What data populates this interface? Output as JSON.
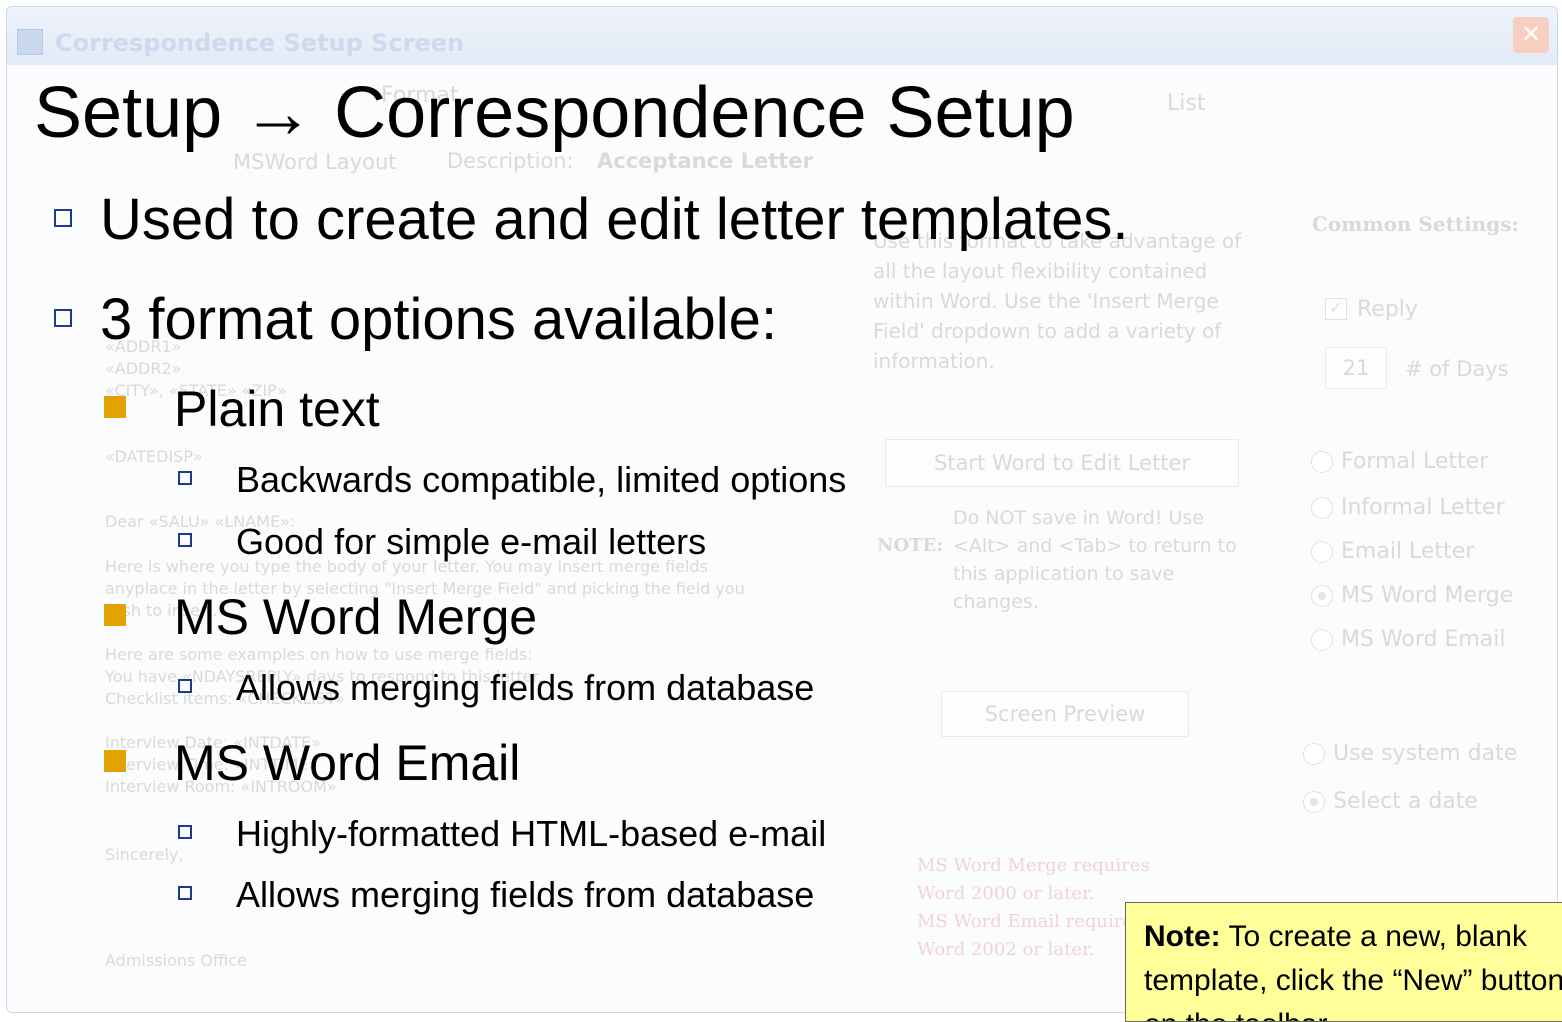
{
  "window": {
    "title": "Correspondence Setup Screen",
    "close_glyph": "✕",
    "labels": {
      "format": "Format",
      "list": "List",
      "msword_layout": "MSWord Layout",
      "description_label": "Description:",
      "description_value": "Acceptance Letter",
      "common_settings": "Common Settings:",
      "reply": "Reply",
      "days_value": "21",
      "days_label": "# of Days",
      "help_line1": "Use this format to take advantage of",
      "help_line2": "all the layout flexibility contained",
      "help_line3": "within Word.  Use the 'Insert Merge",
      "help_line4": "Field' dropdown to add a variety of",
      "help_line5": "information.",
      "start_word_button": "Start Word to Edit Letter",
      "note_label": "NOTE:",
      "note_line1": "Do NOT save in Word!  Use",
      "note_line2": "<Alt> and <Tab> to return to",
      "note_line3": "this application to save",
      "note_line4": "changes.",
      "screen_preview_button": "Screen Preview",
      "use_system_date": "Use system date",
      "select_a_date": "Select a date",
      "req_line1": "MS Word Merge requires",
      "req_line2": "Word 2000 or later.",
      "req_line3": "MS Word Email requires",
      "req_line4": "Word 2002 or later."
    },
    "format_options": [
      "Formal Letter",
      "Informal Letter",
      "Email Letter",
      "MS Word Merge",
      "MS Word Email"
    ],
    "letter_lines": [
      "«ADDR1»",
      "«ADDR2»",
      "«CITY», «STATE» «ZIP»",
      "«DATEDISP»",
      "Dear «SALU» «LNAME»:",
      "Here is where you type the body of your letter.  You may insert merge fields",
      "anyplace in the letter by selecting \"Insert Merge Field\" and picking the field you",
      "wish to insert.",
      "Here are some examples on how to use merge fields:",
      "You have «NDAYSREPLY» days to respond to this letter.",
      "Checklist items: «CHECKLIST»",
      "Interview Date: «INTDATE»",
      "Interview Time: «INTTIME»",
      "Interview Room: «INTROOM»",
      "Sincerely,",
      "Admissions Office"
    ]
  },
  "slide": {
    "title": "Setup → Correspondence Setup",
    "bullets": [
      "Used to create and edit letter templates.",
      "3 format options available:"
    ],
    "options": [
      {
        "label": "Plain text",
        "details": [
          "Backwards compatible, limited options",
          "Good for simple e-mail letters"
        ]
      },
      {
        "label": "MS Word Merge",
        "details": [
          "Allows merging fields from database"
        ]
      },
      {
        "label": "MS Word Email",
        "details": [
          "Highly-formatted HTML-based e-mail",
          "Allows merging fields from database"
        ]
      }
    ],
    "note": {
      "bold": "Note:",
      "text": " To create a new, blank template, click the “New” button on the toolbar."
    }
  }
}
